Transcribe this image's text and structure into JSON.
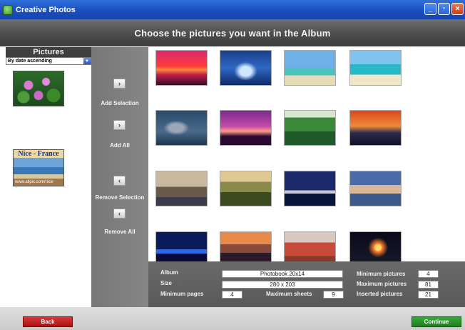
{
  "window": {
    "title": "Creative Photos",
    "minimize_icon": "minimize-icon",
    "restore_icon": "restore-icon",
    "close_icon": "close-icon"
  },
  "header": {
    "title": "Choose the pictures you want in the Album"
  },
  "pictures_panel": {
    "label": "Pictures",
    "sort_value": "By date ascending",
    "items": [
      {
        "name": "lotus-flowers"
      },
      {
        "name": "nice-france",
        "caption": "Nice - France",
        "url": "www.allpix.com/nice"
      }
    ]
  },
  "controls": {
    "add_selection": "Add Selection",
    "add_all": "Add All",
    "remove_selection": "Remove Selection",
    "remove_all": "Remove All",
    "add_selection_glyph": "›",
    "add_all_glyph": "›",
    "remove_selection_glyph": "‹",
    "remove_all_glyph": "‹"
  },
  "gallery": {
    "thumbnails": [
      "red-sunset-sea",
      "blue-ocean-wave",
      "palm-beach-tropical",
      "turquoise-lagoon",
      "dolphins-underwater",
      "palm-silhouette-purple-sky",
      "great-wall-green-hills",
      "red-sky-rock-formations",
      "tower-bridge-london",
      "rolling-hills-landscape",
      "sydney-opera-house-night",
      "lakeside-town-church",
      "city-skyline-night-blue",
      "coastal-city-sunset",
      "red-roofs-old-town",
      "fireworks-night"
    ]
  },
  "info": {
    "album_label": "Album",
    "album_value": "Photobook 20x14",
    "size_label": "Size",
    "size_value": "280 x 203",
    "min_pages_label": "Minimum pages",
    "min_pages_value": "4",
    "max_sheets_label": "Maximum sheets",
    "max_sheets_value": "9",
    "min_pictures_label": "Minimum pictures",
    "min_pictures_value": "4",
    "max_pictures_label": "Maximum pictures",
    "max_pictures_value": "81",
    "inserted_pictures_label": "Inserted pictures",
    "inserted_pictures_value": "21"
  },
  "footer": {
    "back_label": "Back",
    "continue_label": "Continue"
  },
  "colors": {
    "back": "#c42020",
    "continue": "#2a962a",
    "titlebar": "#2358c8"
  }
}
